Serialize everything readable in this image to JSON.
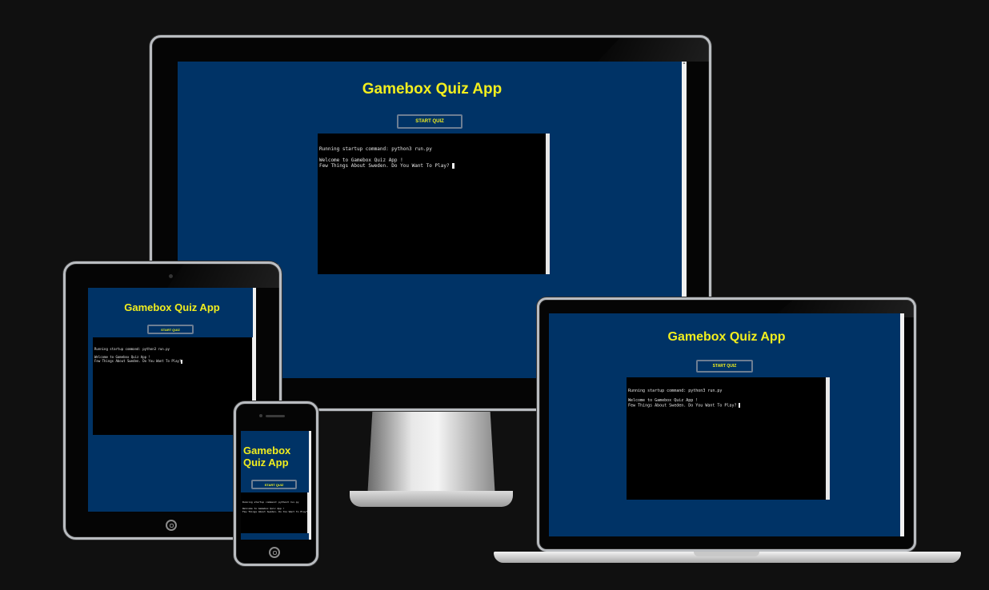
{
  "app": {
    "title": "Gamebox Quiz App",
    "start_button_label": "START QUIZ",
    "terminal_lines": [
      "Running startup command: python3 run.py",
      "",
      "Welcome to Gamebox Quiz App !",
      "Few Things About Sweden. Do You Want To Play?"
    ]
  },
  "colors": {
    "page_background": "#101010",
    "app_background": "#003366",
    "title_color": "#f2ee1e",
    "terminal_background": "#000000",
    "terminal_text": "#e6e6e6"
  },
  "devices": [
    "desktop-monitor",
    "tablet",
    "laptop",
    "phone"
  ]
}
